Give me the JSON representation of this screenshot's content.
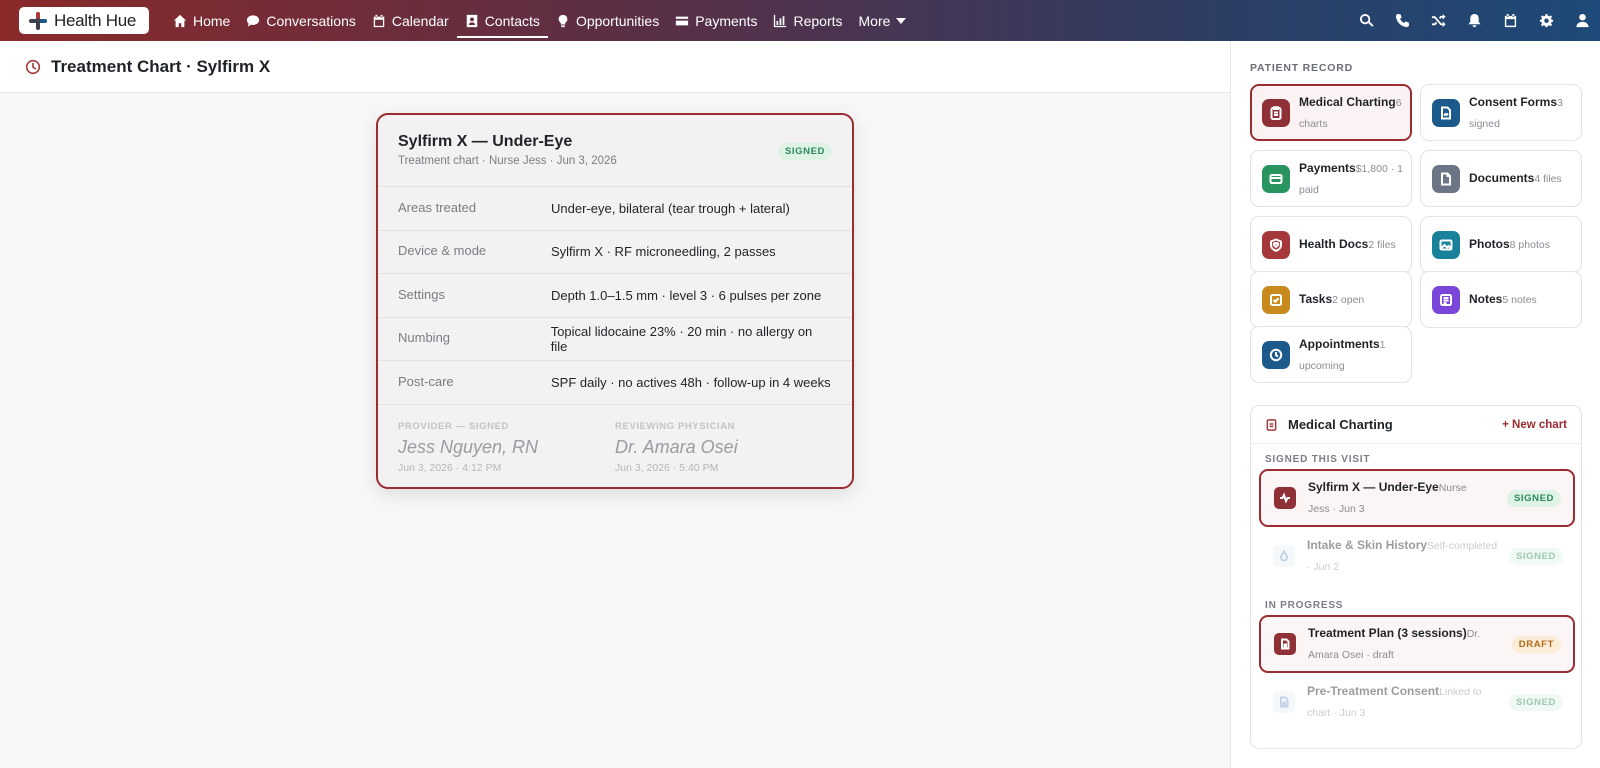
{
  "app": {
    "name": "Health Hue"
  },
  "nav": {
    "items": [
      {
        "label": "Home",
        "icon": "home-icon"
      },
      {
        "label": "Conversations",
        "icon": "chat-icon"
      },
      {
        "label": "Calendar",
        "icon": "calendar-icon"
      },
      {
        "label": "Contacts",
        "icon": "contacts-icon",
        "active": true
      },
      {
        "label": "Opportunities",
        "icon": "lightbulb-icon"
      },
      {
        "label": "Payments",
        "icon": "card-icon"
      },
      {
        "label": "Reports",
        "icon": "chart-icon"
      },
      {
        "label": "More",
        "icon": "caret-down-icon"
      }
    ],
    "right_icons": [
      "search-icon",
      "phone-icon",
      "shuffle-icon",
      "bell-icon",
      "calendar-icon",
      "gear-icon",
      "user-icon"
    ]
  },
  "page": {
    "title": "Treatment Chart · Sylfirm X"
  },
  "chart": {
    "title": "Sylfirm X — Under-Eye",
    "subtitle": "Treatment chart · Nurse Jess · Jun 3, 2026",
    "status": "SIGNED",
    "rows": [
      {
        "label": "Areas treated",
        "value": "Under-eye, bilateral (tear trough + lateral)"
      },
      {
        "label": "Device & mode",
        "value": "Sylfirm X · RF microneedling, 2 passes"
      },
      {
        "label": "Settings",
        "value": "Depth 1.0–1.5 mm · level 3 · 6 pulses per zone"
      },
      {
        "label": "Numbing",
        "value": "Topical lidocaine 23% · 20 min · no allergy on file"
      },
      {
        "label": "Post-care",
        "value": "SPF daily · no actives 48h · follow-up in 4 weeks"
      }
    ],
    "provider": {
      "label": "PROVIDER — SIGNED",
      "name": "Jess Nguyen, RN",
      "date": "Jun 3, 2026 · 4:12 PM"
    },
    "physician": {
      "label": "REVIEWING PHYSICIAN",
      "name": "Dr. Amara Osei",
      "date": "Jun 3, 2026 · 5:40 PM"
    }
  },
  "sidebar": {
    "section_label": "PATIENT RECORD",
    "tiles": [
      {
        "name": "Medical Charting",
        "count": "6",
        "meta": "charts",
        "color": "#8f3037",
        "icon": "clipboard-icon"
      },
      {
        "name": "Consent Forms",
        "count": "3",
        "meta": "signed",
        "color": "#1d5a8c",
        "icon": "file-sign-icon"
      },
      {
        "name": "Payments",
        "count": "$1,800 · 1",
        "meta": "paid",
        "color": "#2a9461",
        "icon": "card-icon"
      },
      {
        "name": "Documents",
        "count": "4 files",
        "meta": "",
        "color": "#6b7586",
        "icon": "document-icon"
      },
      {
        "name": "Health Docs",
        "count": "2 files",
        "meta": "",
        "color": "#a5383a",
        "icon": "heart-shield-icon"
      },
      {
        "name": "Photos",
        "count": "8 photos",
        "meta": "",
        "color": "#19819a",
        "icon": "image-icon"
      },
      {
        "name": "Tasks",
        "count": "2 open",
        "meta": "",
        "color": "#c88a1c",
        "icon": "checkbox-icon"
      },
      {
        "name": "Notes",
        "count": "5 notes",
        "meta": "",
        "color": "#7a45d9",
        "icon": "note-icon"
      },
      {
        "name": "Appointments",
        "count": "1",
        "meta": "upcoming",
        "color": "#1d5a8c",
        "icon": "clock-icon"
      }
    ],
    "charting": {
      "title": "Medical Charting",
      "new_label": "+ New chart",
      "group_signed": "SIGNED THIS VISIT",
      "group_progress": "IN PROGRESS",
      "items": [
        {
          "name": "Sylfirm X — Under-Eye",
          "meta_inline": "Nurse",
          "meta": "Jess · Jun 3",
          "status": "SIGNED"
        },
        {
          "name": "Intake & Skin History",
          "meta_inline": "Self-completed",
          "meta": "· Jun 2",
          "status": "SIGNED"
        },
        {
          "name": "Treatment Plan (3 sessions)",
          "meta_inline": "Dr.",
          "meta": "Amara Osei · draft",
          "status": "DRAFT"
        },
        {
          "name": "Pre-Treatment Consent",
          "meta_inline": "Linked to",
          "meta": "chart · Jun 3",
          "status": "SIGNED"
        }
      ]
    }
  }
}
